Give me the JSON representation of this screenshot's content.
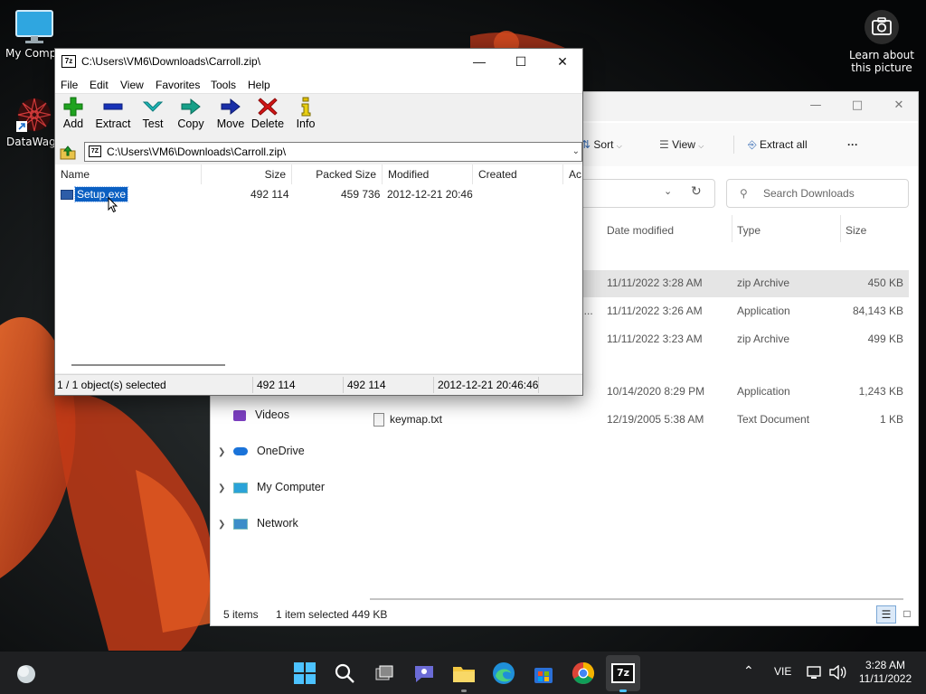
{
  "desktop": {
    "icons": [
      {
        "label": "My Compu"
      },
      {
        "label": "DataWago"
      }
    ],
    "learn_text": "Learn about this picture"
  },
  "explorer": {
    "toolbar": {
      "sort": "Sort",
      "view": "View",
      "extract_all": "Extract all",
      "more": "···"
    },
    "search_placeholder": "Search Downloads",
    "columns": {
      "date": "Date modified",
      "type": "Type",
      "size": "Size"
    },
    "rows": [
      {
        "name": "",
        "date": "11/11/2022 3:28 AM",
        "type": "zip Archive",
        "size": "450 KB"
      },
      {
        "name": "i...",
        "date": "11/11/2022 3:26 AM",
        "type": "Application",
        "size": "84,143 KB"
      },
      {
        "name": "",
        "date": "11/11/2022 3:23 AM",
        "type": "zip Archive",
        "size": "499 KB"
      },
      {
        "name": "",
        "date": "10/14/2020 8:29 PM",
        "type": "Application",
        "size": "1,243 KB"
      },
      {
        "name": "keymap.txt",
        "date": "12/19/2005 5:38 AM",
        "type": "Text Document",
        "size": "1 KB"
      }
    ],
    "nav": [
      {
        "label": "Videos"
      },
      {
        "label": "OneDrive"
      },
      {
        "label": "My Computer"
      },
      {
        "label": "Network"
      }
    ],
    "status": {
      "items": "5 items",
      "selected": "1 item selected",
      "size": "449 KB"
    }
  },
  "zip": {
    "title": "C:\\Users\\VM6\\Downloads\\Carroll.zip\\",
    "app_icon": "7z",
    "menu": [
      "File",
      "Edit",
      "View",
      "Favorites",
      "Tools",
      "Help"
    ],
    "tools": [
      "Add",
      "Extract",
      "Test",
      "Copy",
      "Move",
      "Delete",
      "Info"
    ],
    "path": "C:\\Users\\VM6\\Downloads\\Carroll.zip\\",
    "columns": {
      "name": "Name",
      "size": "Size",
      "packed": "Packed Size",
      "modified": "Modified",
      "created": "Created",
      "accessed": "Ac"
    },
    "file": {
      "name": "Setup.exe",
      "size": "492 114",
      "packed": "459 736",
      "modified": "2012-12-21 20:46"
    },
    "status": {
      "selected": "1 / 1 object(s) selected",
      "size": "492 114",
      "packed": "492 114",
      "date": "2012-12-21 20:46:46"
    }
  },
  "taskbar": {
    "lang": "VIE",
    "time": "3:28 AM",
    "date": "11/11/2022",
    "sevenzip_label": "7z"
  },
  "colors": {
    "accent": "#0a5fc2",
    "taskbar": "#1f2022",
    "delete_red": "#d21414",
    "add_green": "#1fa31f"
  }
}
